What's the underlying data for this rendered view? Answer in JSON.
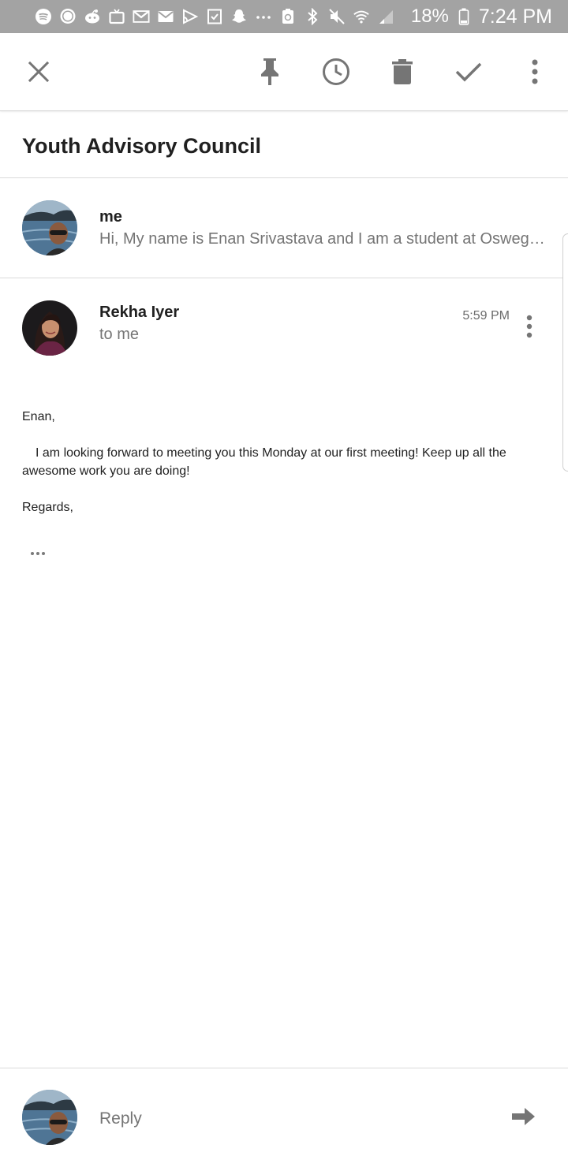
{
  "status_bar": {
    "battery_percent": "18%",
    "time": "7:24 PM",
    "icons": [
      "spotify-icon",
      "chat-bubble-icon",
      "reddit-icon",
      "tv-icon",
      "gmail-icon",
      "mail-icon",
      "cast-icon",
      "checklist-icon",
      "snapchat-icon",
      "more-dots-icon",
      "battery-saver-icon",
      "bluetooth-icon",
      "mute-icon",
      "wifi-icon",
      "signal-icon",
      "battery-icon"
    ]
  },
  "toolbar": {
    "actions": [
      "close-icon",
      "pin-icon",
      "snooze-clock-icon",
      "trash-icon",
      "done-check-icon",
      "overflow-menu-icon"
    ]
  },
  "thread": {
    "subject": "Youth Advisory Council",
    "collapsed_message": {
      "sender": "me",
      "snippet": "Hi, My name is Enan Srivastava and I am a student at Oswego East High School."
    },
    "expanded_message": {
      "sender": "Rekha Iyer",
      "recipient": "to me",
      "time": "5:59 PM",
      "greeting": "Enan,",
      "paragraph": "I am looking forward to meeting you this Monday at our first meeting! Keep up all the awesome work you are doing!",
      "closing": "Regards,"
    }
  },
  "reply": {
    "placeholder": "Reply"
  },
  "colors": {
    "status_bar": "#a3a3a3",
    "icon_gray": "#757575",
    "secondary_text": "#757575"
  }
}
